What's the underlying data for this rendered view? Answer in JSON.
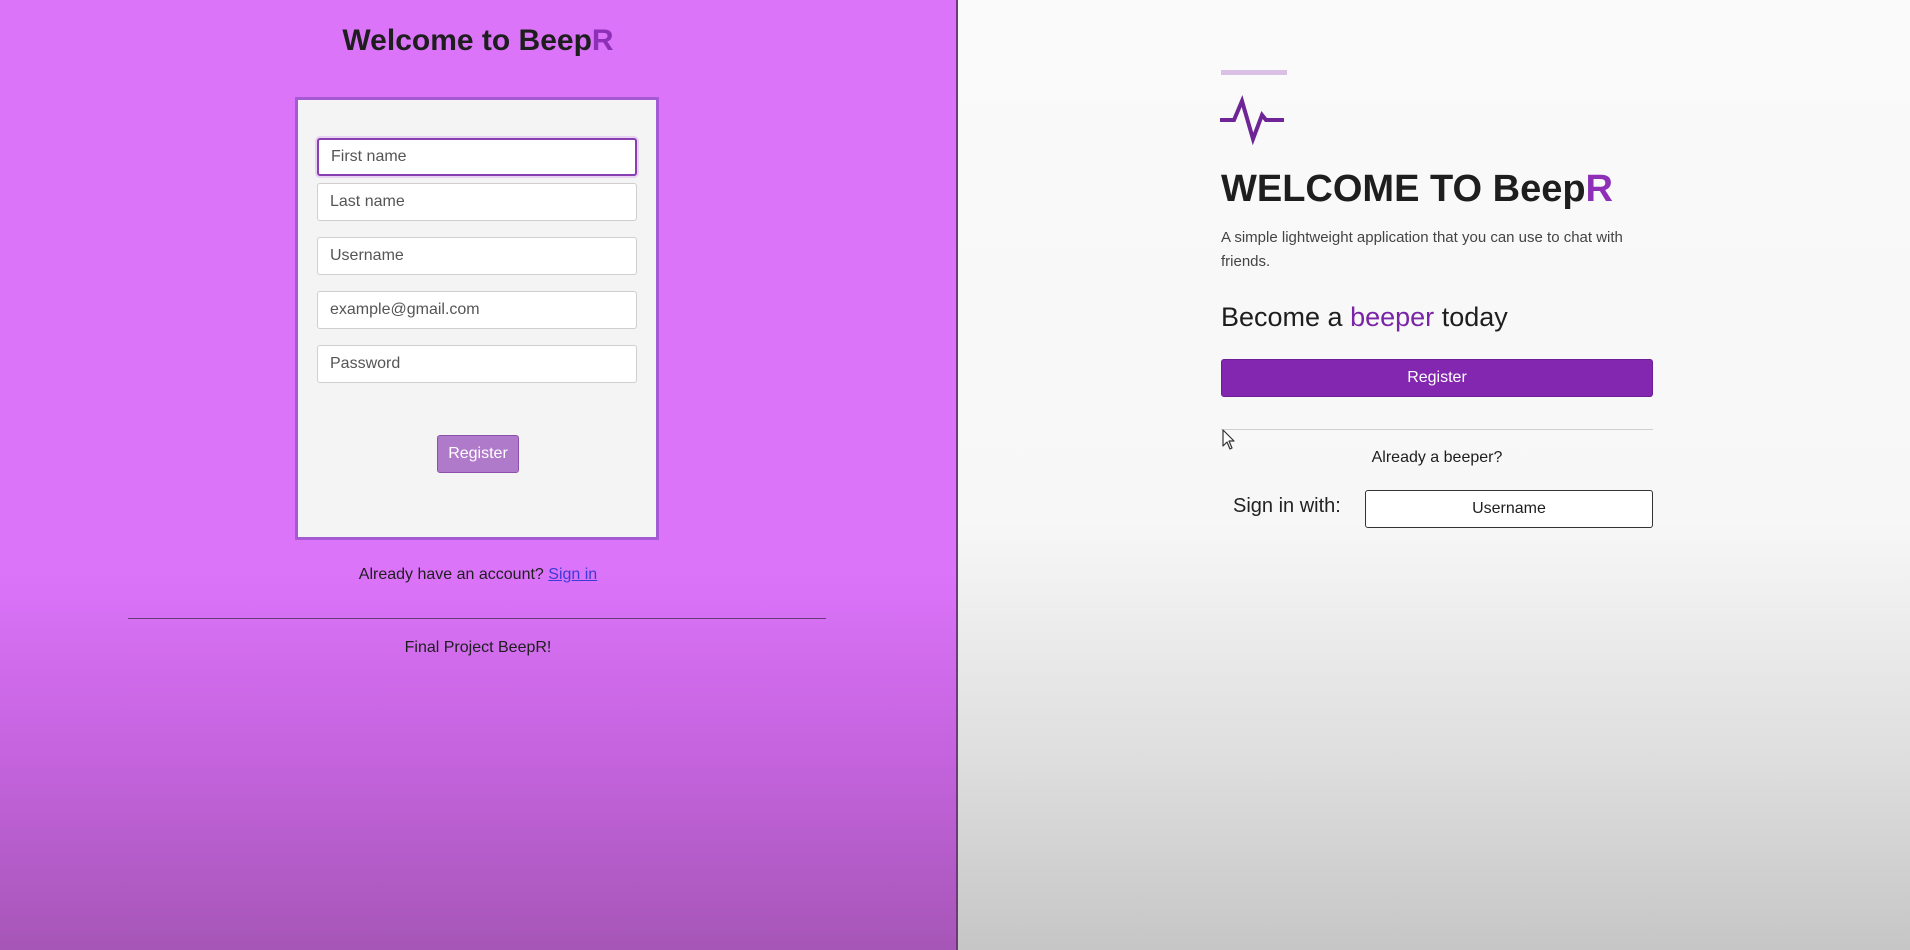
{
  "left": {
    "title_prefix": "Welcome to Beep",
    "title_accent": "R",
    "form": {
      "first_name_placeholder": "First name",
      "last_name_placeholder": "Last name",
      "username_placeholder": "Username",
      "email_placeholder": "example@gmail.com",
      "password_placeholder": "Password",
      "register_label": "Register"
    },
    "have_account_text": "Already have an account?",
    "sign_in_link": "Sign in",
    "footer": "Final Project BeepR!"
  },
  "right": {
    "title_prefix": "WELCOME TO Beep",
    "title_accent": "R",
    "subtitle": "A simple lightweight application that you can use to chat with friends.",
    "become_prefix": "Become a",
    "become_accent": "beeper",
    "become_suffix": "today",
    "register_label": "Register",
    "already_text": "Already a beeper?",
    "sign_in_with": "Sign in with:",
    "username_button": "Username"
  },
  "icons": {
    "logo": "pulse-line-icon",
    "cursor": "mouse-pointer-icon"
  },
  "colors": {
    "left_bg": "#dc74fa",
    "accent": "#8327b1",
    "accent_text": "#7a24a8"
  }
}
